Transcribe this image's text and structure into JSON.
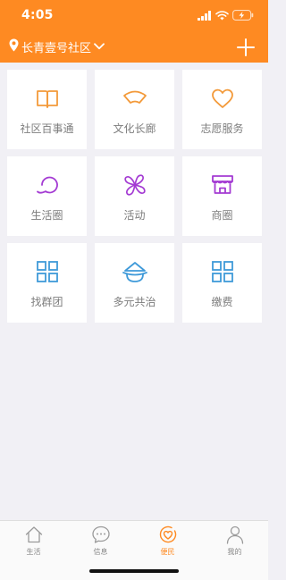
{
  "status_bar": {
    "time": "4:05"
  },
  "header": {
    "community_name": "长青壹号社区",
    "location_icon": "location-pin-icon",
    "dropdown_icon": "chevron-down-icon",
    "add_icon": "plus-icon",
    "background_color": "#fe8a22"
  },
  "grid": {
    "items": [
      {
        "label": "社区百事通",
        "icon": "open-book-icon",
        "color": "#f39a3a"
      },
      {
        "label": "文化长廊",
        "icon": "folding-fan-icon",
        "color": "#f39a3a"
      },
      {
        "label": "志愿服务",
        "icon": "heart-icon",
        "color": "#f39a3a"
      },
      {
        "label": "生活圈",
        "icon": "circle-loop-icon",
        "color": "#a43bd3"
      },
      {
        "label": "活动",
        "icon": "pinwheel-icon",
        "color": "#a43bd3"
      },
      {
        "label": "商圈",
        "icon": "storefront-icon",
        "color": "#a43bd3"
      },
      {
        "label": "找群团",
        "icon": "grid-squares-icon",
        "color": "#3f9ad9"
      },
      {
        "label": "多元共治",
        "icon": "hat-icon",
        "color": "#3f9ad9"
      },
      {
        "label": "缴费",
        "icon": "grid-squares-icon",
        "color": "#3f9ad9"
      }
    ]
  },
  "tabbar": {
    "active_color": "#fe8a22",
    "items": [
      {
        "label": "生活",
        "icon": "house-icon",
        "active": false
      },
      {
        "label": "信息",
        "icon": "chat-bubble-icon",
        "active": false
      },
      {
        "label": "便民",
        "icon": "heart-circle-icon",
        "active": true
      },
      {
        "label": "我的",
        "icon": "person-icon",
        "active": false
      }
    ]
  }
}
